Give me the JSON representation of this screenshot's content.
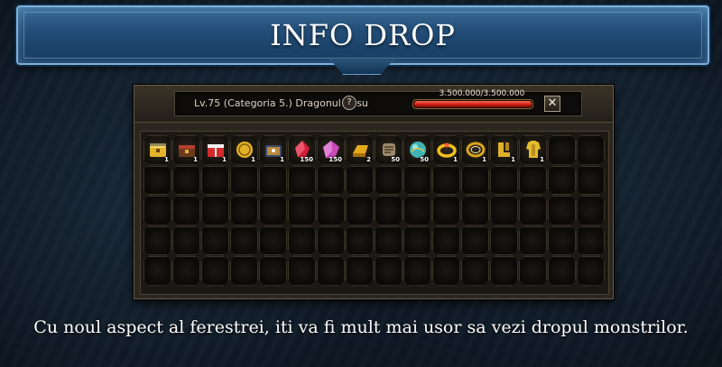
{
  "banner": {
    "title": "INFO DROP"
  },
  "window": {
    "monster_name": "Lv.75 (Categoria 5.) Dragonul Rosu",
    "help_label": "?",
    "hp_text": "3.500.000/3.500.000",
    "hp_fraction": 1.0,
    "close_label": "✕"
  },
  "inventory": {
    "columns": 16,
    "rows": 5,
    "items": [
      {
        "icon": "yellow-chest-icon",
        "qty": "1",
        "color": "#e3b52a"
      },
      {
        "icon": "wooden-chest-icon",
        "qty": "1",
        "color": "#b5402c"
      },
      {
        "icon": "red-box-icon",
        "qty": "1",
        "color": "#d42a2a"
      },
      {
        "icon": "gold-coin-icon",
        "qty": "1",
        "color": "#e2b227"
      },
      {
        "icon": "ornate-chest-icon",
        "qty": "1",
        "color": "#b98a3c"
      },
      {
        "icon": "red-crystal-icon",
        "qty": "150",
        "color": "#d11e3a"
      },
      {
        "icon": "pink-crystal-icon",
        "qty": "150",
        "color": "#c94ab8"
      },
      {
        "icon": "gold-bar-icon",
        "qty": "2",
        "color": "#e7a91c"
      },
      {
        "icon": "scroll-icon",
        "qty": "50",
        "color": "#9d8a6a"
      },
      {
        "icon": "teal-orb-icon",
        "qty": "50",
        "color": "#3fb4b3"
      },
      {
        "icon": "gold-ring-icon",
        "qty": "1",
        "color": "#f0c020"
      },
      {
        "icon": "gold-bracelet-icon",
        "qty": "1",
        "color": "#d9a51c"
      },
      {
        "icon": "gold-boots-icon",
        "qty": "1",
        "color": "#e0b02a"
      },
      {
        "icon": "gold-armor-icon",
        "qty": "1",
        "color": "#e5bb2e"
      }
    ]
  },
  "caption": "Cu noul aspect al ferestrei, iti va fi mult mai usor sa vezi dropul monstrilor."
}
